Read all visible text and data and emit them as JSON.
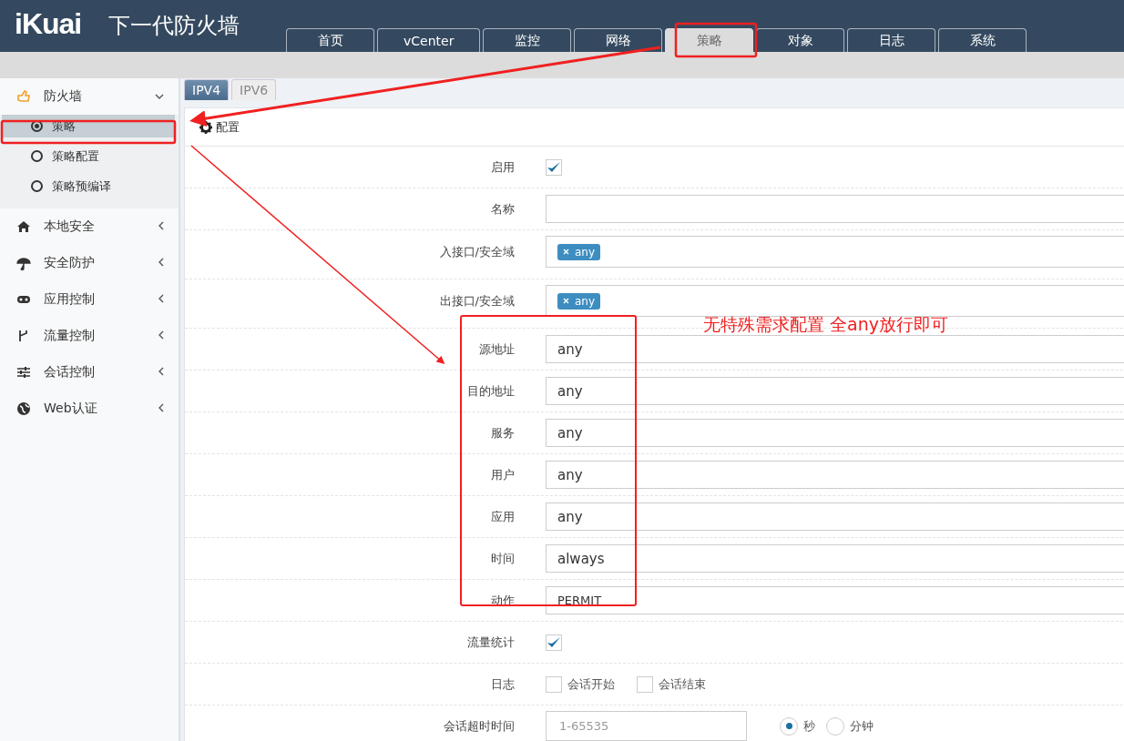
{
  "header": {
    "logo": "iKuai",
    "title": "下一代防火墙"
  },
  "nav_tabs": [
    {
      "label": "首页",
      "selected": false
    },
    {
      "label": "vCenter",
      "selected": false
    },
    {
      "label": "监控",
      "selected": false
    },
    {
      "label": "网络",
      "selected": false
    },
    {
      "label": "策略",
      "selected": true
    },
    {
      "label": "对象",
      "selected": false
    },
    {
      "label": "日志",
      "selected": false
    },
    {
      "label": "系统",
      "selected": false
    }
  ],
  "sidebar": {
    "items": [
      {
        "label": "防火墙",
        "expanded": true,
        "children": [
          {
            "label": "策略",
            "selected": true
          },
          {
            "label": "策略配置",
            "selected": false
          },
          {
            "label": "策略预编译",
            "selected": false
          }
        ]
      },
      {
        "label": "本地安全",
        "expanded": false
      },
      {
        "label": "安全防护",
        "expanded": false
      },
      {
        "label": "应用控制",
        "expanded": false
      },
      {
        "label": "流量控制",
        "expanded": false
      },
      {
        "label": "会话控制",
        "expanded": false
      },
      {
        "label": "Web认证",
        "expanded": false
      }
    ]
  },
  "ip_tabs": [
    {
      "label": "IPV4",
      "selected": true
    },
    {
      "label": "IPV6",
      "selected": false
    }
  ],
  "panel": {
    "title": "配置",
    "rows": [
      {
        "kind": "checkbox",
        "label": "启用",
        "checked": true
      },
      {
        "kind": "text",
        "label": "名称"
      },
      {
        "kind": "tags",
        "label": "入接口/安全域",
        "tags": [
          "any"
        ]
      },
      {
        "kind": "tags",
        "label": "出接口/安全域",
        "tags": [
          "any"
        ]
      },
      {
        "kind": "value",
        "label": "源地址",
        "value": "any"
      },
      {
        "kind": "value",
        "label": "目的地址",
        "value": "any"
      },
      {
        "kind": "value",
        "label": "服务",
        "value": "any"
      },
      {
        "kind": "value",
        "label": "用户",
        "value": "any"
      },
      {
        "kind": "value",
        "label": "应用",
        "value": "any"
      },
      {
        "kind": "value",
        "label": "时间",
        "value": "always"
      },
      {
        "kind": "select",
        "label": "动作",
        "value": "PERMIT"
      },
      {
        "kind": "checkbox",
        "label": "流量统计",
        "checked": true
      },
      {
        "kind": "options",
        "label": "日志",
        "options": [
          {
            "label": "会话开始",
            "checked": false
          },
          {
            "label": "会话结束",
            "checked": false
          }
        ]
      },
      {
        "kind": "timeout",
        "label": "会话超时时间",
        "placeholder": "1-65535",
        "units": [
          {
            "label": "秒",
            "selected": true
          },
          {
            "label": "分钟",
            "selected": false
          }
        ]
      }
    ]
  },
  "annotation": {
    "text": "无特殊需求配置 全any放行即可"
  }
}
